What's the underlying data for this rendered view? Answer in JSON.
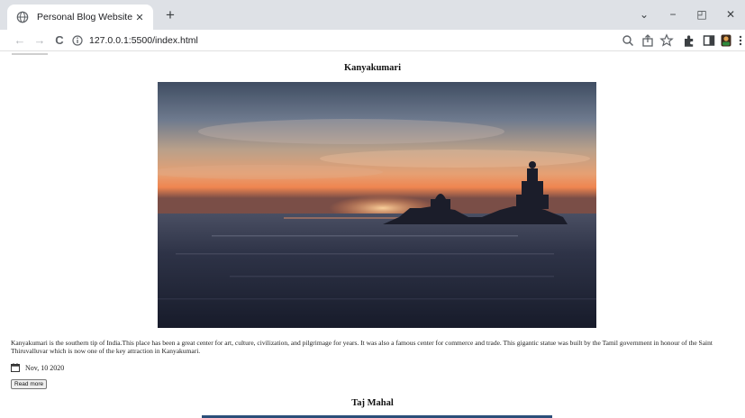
{
  "browser": {
    "tab_title": "Personal Blog Website",
    "tab_close": "✕",
    "new_tab": "+",
    "url": "127.0.0.1:5500/index.html",
    "nav": {
      "back": "←",
      "forward": "→",
      "reload": "C"
    },
    "window_controls": {
      "dropdown": "⌄",
      "minimize": "−",
      "restore": "◰",
      "close": "✕"
    }
  },
  "posts": [
    {
      "title": "Kanyakumari",
      "description": "Kanyakumari is the southern tip of India.This place has been a great center for art, culture, civilization, and pilgrimage for years. It was also a famous center for commerce and trade. This gigantic statue was built by the Tamil government in honour of the Saint Thiruvalluvar which is now one of the key attraction in Kanyakumari.",
      "date": "Nov, 10 2020",
      "read_more": "Read more"
    },
    {
      "title": "Taj Mahal"
    }
  ]
}
